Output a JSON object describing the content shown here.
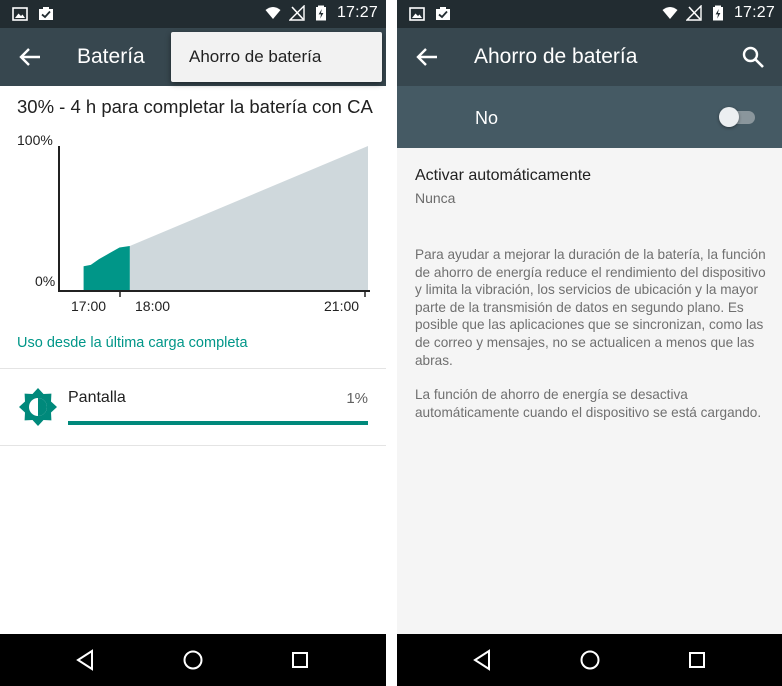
{
  "status_bar": {
    "time": "17:27",
    "left_icons": [
      "image-icon",
      "task-check-icon"
    ],
    "right_icons": [
      "wifi-icon",
      "no-signal-icon",
      "battery-icon"
    ]
  },
  "left_screen": {
    "app_bar": {
      "title": "Batería",
      "back_icon": "arrow-back-icon"
    },
    "overflow_menu": {
      "items": [
        {
          "label": "Ahorro de batería"
        }
      ]
    },
    "charge_status": "30% - 4 h para completar la batería con CA",
    "chart_data": {
      "type": "area",
      "y_tick_labels": [
        "100%",
        "0%"
      ],
      "x_tick_labels": [
        "17:00",
        "18:00",
        "21:00"
      ],
      "ylim": [
        0,
        100
      ],
      "series": [
        {
          "role": "history",
          "color": "#009688",
          "x": [
            "16:45",
            "16:52",
            "17:00",
            "17:10",
            "17:20",
            "17:30"
          ],
          "y": [
            17,
            18,
            22,
            26,
            30,
            31
          ]
        },
        {
          "role": "prediction",
          "color": "#cfd8dc",
          "x": [
            "17:30",
            "21:30"
          ],
          "y": [
            31,
            100
          ]
        }
      ]
    },
    "usage_link": "Uso desde la última carga completa",
    "usage_items": [
      {
        "name": "Pantalla",
        "percent_label": "1%",
        "fraction": 1.0,
        "icon": "brightness-icon"
      }
    ]
  },
  "right_screen": {
    "app_bar": {
      "title": "Ahorro de batería",
      "back_icon": "arrow-back-icon",
      "search_icon": "search-icon"
    },
    "master_switch": {
      "label": "No",
      "enabled": false
    },
    "auto_activate": {
      "title": "Activar automáticamente",
      "value": "Nunca"
    },
    "description_1": "Para ayudar a mejorar la duración de la batería, la función de ahorro de energía reduce el rendimiento del dispositivo y limita la vibración, los servicios de ubicación y la mayor parte de la transmisión de datos en segundo plano. Es posible que las aplicaciones que se sincronizan, como las de correo y mensajes, no se actualicen a menos que las abras.",
    "description_2": "La función de ahorro de energía se desactiva automáticamente cuando el dispositivo se está cargando."
  },
  "navigation_bar": {
    "buttons": [
      "nav-back-icon",
      "nav-home-icon",
      "nav-recents-icon"
    ]
  },
  "colors": {
    "accent": "#009688",
    "appbar": "#37474f",
    "statusbar": "#222c31",
    "switch_row": "#455a64"
  }
}
